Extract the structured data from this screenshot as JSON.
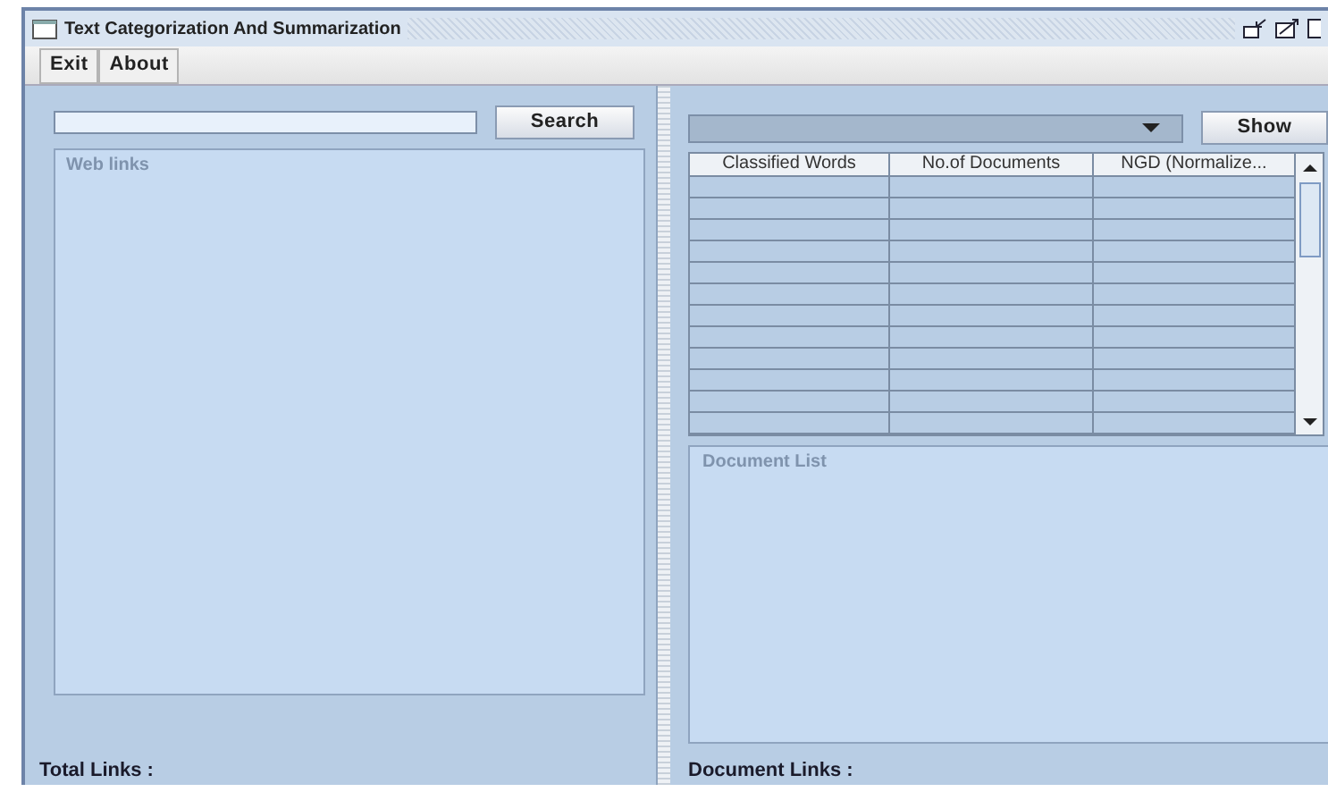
{
  "window": {
    "title": "Text Categorization And Summarization"
  },
  "menu": [
    "Exit",
    "About"
  ],
  "left": {
    "search_button": "Search",
    "web_links_title": "Web links",
    "total_links_label": "Total Links :"
  },
  "right": {
    "show_button": "Show",
    "table": {
      "columns": [
        "Classified Words",
        "No.of Documents",
        "NGD (Normalize..."
      ]
    },
    "document_list_title": "Document List",
    "document_links_label": "Document Links :"
  }
}
